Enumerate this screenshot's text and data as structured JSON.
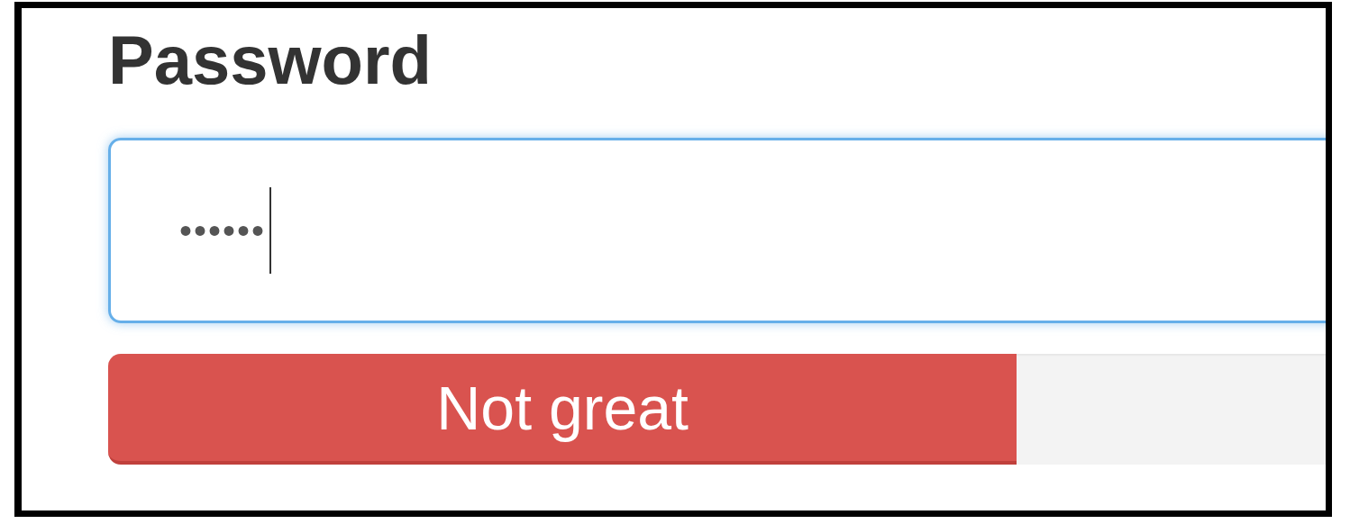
{
  "label": "Password",
  "password_field": {
    "value": "••••••",
    "focused": true
  },
  "strength_meter": {
    "label": "Not great",
    "level": 0.71
  }
}
